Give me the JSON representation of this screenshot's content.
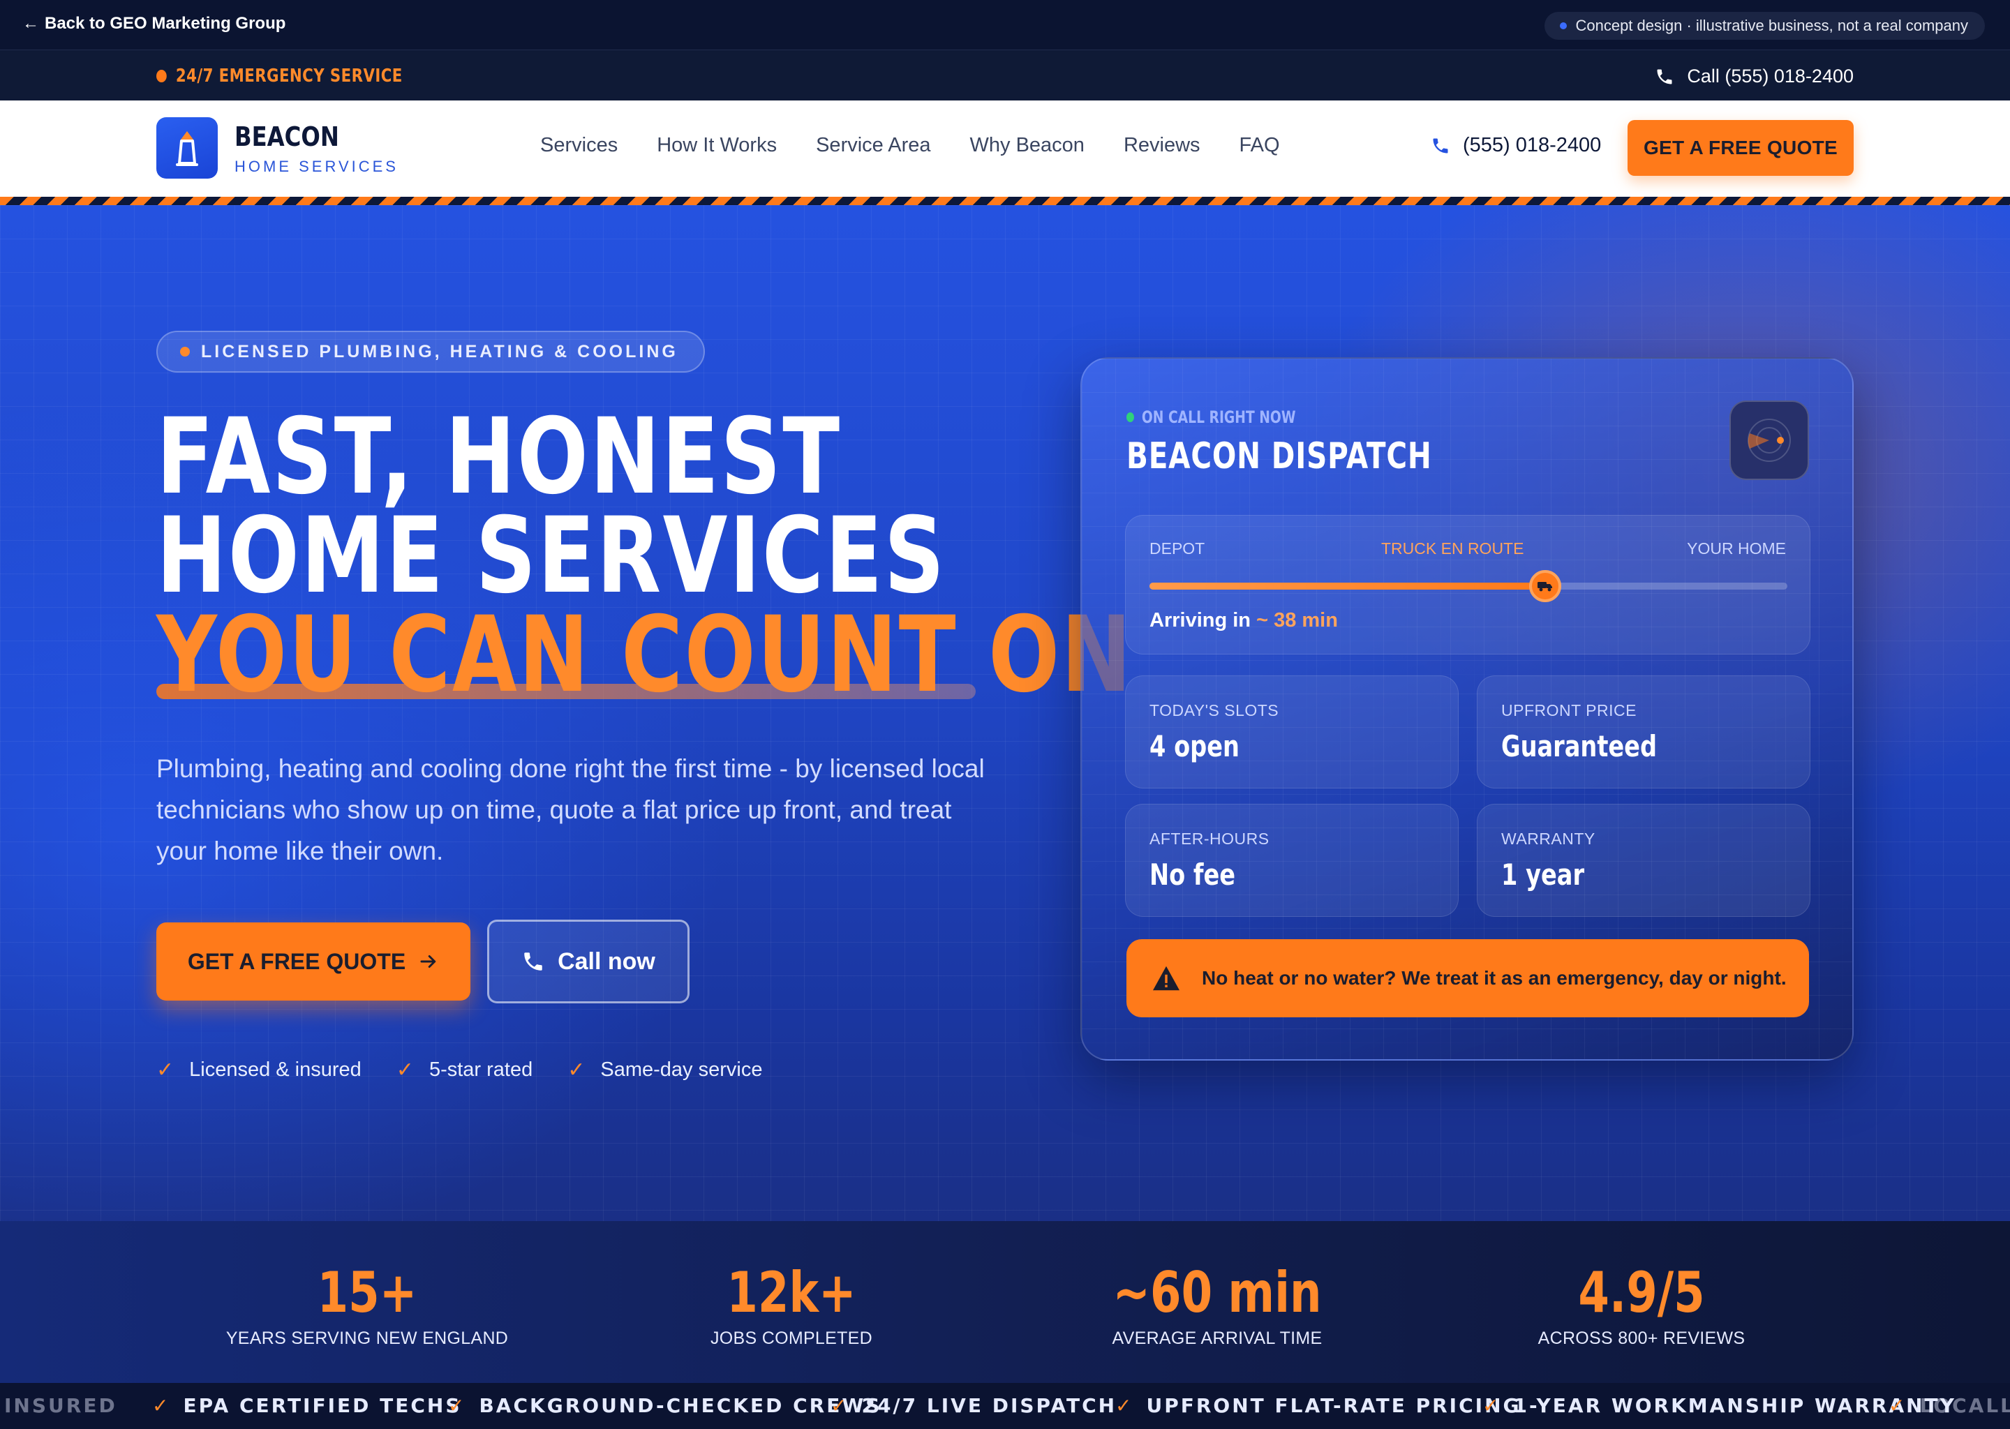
{
  "concept_bar": {
    "back_label": "Back to GEO Marketing Group",
    "notice_strong": "Concept design",
    "notice_rest": " · illustrative business, not a real company"
  },
  "emergency_bar": {
    "label": "24/7 EMERGENCY SERVICE",
    "call": "Call (555) 018-2400"
  },
  "nav": {
    "brand": "BEACON",
    "brand_sub": "HOME SERVICES",
    "links": [
      "Services",
      "How It Works",
      "Service Area",
      "Why Beacon",
      "Reviews",
      "FAQ"
    ],
    "phone": "(555) 018-2400",
    "cta": "GET A FREE QUOTE"
  },
  "hero": {
    "pill": "LICENSED PLUMBING, HEATING & COOLING",
    "headline_1": "FAST, HONEST",
    "headline_2": "HOME SERVICES",
    "headline_3": "YOU CAN COUNT ON",
    "description": "Plumbing, heating and cooling done right the first time - by licensed local technicians who show up on time, quote a flat price up front, and treat your home like their own.",
    "cta_primary": "GET A FREE QUOTE",
    "cta_secondary": "Call now",
    "trust": [
      "Licensed & insured",
      "5-star rated",
      "Same-day service"
    ]
  },
  "dispatch": {
    "status": "ON CALL RIGHT NOW",
    "title": "BEACON DISPATCH",
    "route_labels": [
      "DEPOT",
      "TRUCK EN ROUTE",
      "YOUR HOME"
    ],
    "route_progress": 0.62,
    "arriving_prefix": "Arriving in ",
    "arriving_eta": "~ 38 min",
    "tiles": [
      {
        "label": "TODAY'S SLOTS",
        "value": "4 open"
      },
      {
        "label": "UPFRONT PRICE",
        "value": "Guaranteed"
      },
      {
        "label": "AFTER-HOURS",
        "value": "No fee"
      },
      {
        "label": "WARRANTY",
        "value": "1 year"
      }
    ],
    "emergency": "No heat or no water? We treat it as an emergency, day or night."
  },
  "stats": [
    {
      "value": "15+",
      "caption": "YEARS SERVING NEW ENGLAND"
    },
    {
      "value": "12k+",
      "caption": "JOBS COMPLETED"
    },
    {
      "value": "~60 min",
      "caption": "AVERAGE ARRIVAL TIME"
    },
    {
      "value": "4.9/5",
      "caption": "ACROSS 800+ REVIEWS"
    }
  ],
  "ticker": {
    "lead_fragment": "INSURED",
    "items": [
      "EPA CERTIFIED TECHS",
      "BACKGROUND-CHECKED CREWS",
      "24/7 LIVE DISPATCH",
      "UPFRONT FLAT-RATE PRICING",
      "1-YEAR WORKMANSHIP WARRANTY"
    ],
    "tail_fragment": "LOCALLY"
  },
  "colors": {
    "accent": "#ff7a1a",
    "brand_blue": "#2552e0",
    "navy": "#0d1838",
    "status_green": "#2fd27a"
  }
}
